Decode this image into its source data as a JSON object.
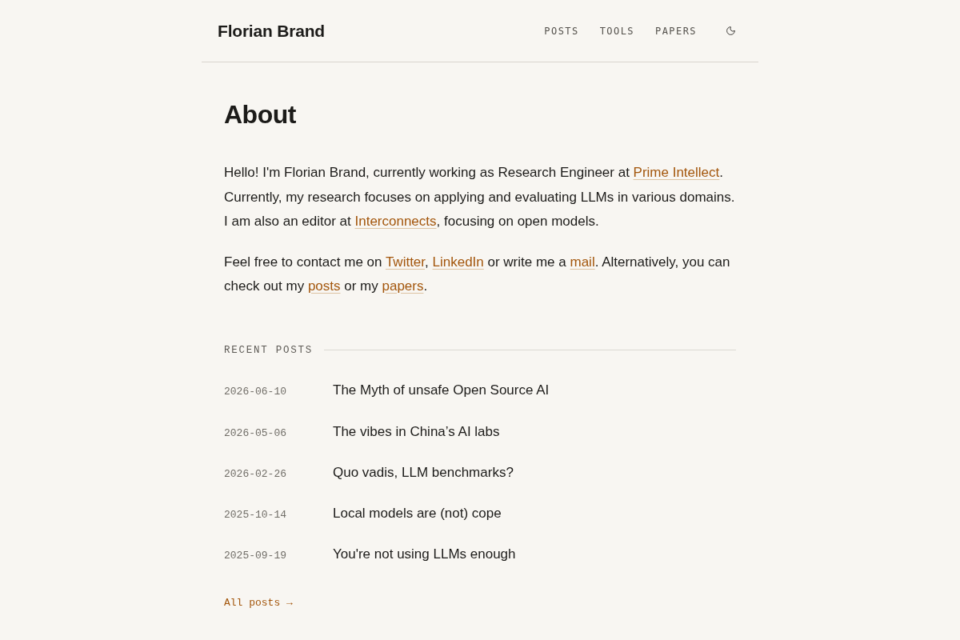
{
  "header": {
    "title": "Florian Brand",
    "nav": [
      "POSTS",
      "TOOLS",
      "PAPERS"
    ]
  },
  "page_title": "About",
  "paragraphs": [
    [
      {
        "kind": "text",
        "text": "Hello! I'm Florian Brand, currently working as Research Engineer at "
      },
      {
        "kind": "link",
        "text": "Prime Intellect"
      },
      {
        "kind": "text",
        "text": ". Currently, my research focuses on applying and evaluating LLMs in various domains. I am also an editor at "
      },
      {
        "kind": "link",
        "text": "Interconnects"
      },
      {
        "kind": "text",
        "text": ", focusing on open models."
      }
    ],
    [
      {
        "kind": "text",
        "text": "Feel free to contact me on "
      },
      {
        "kind": "link",
        "text": "Twitter"
      },
      {
        "kind": "text",
        "text": ", "
      },
      {
        "kind": "link",
        "text": "LinkedIn"
      },
      {
        "kind": "text",
        "text": " or write me a "
      },
      {
        "kind": "link",
        "text": "mail"
      },
      {
        "kind": "text",
        "text": ". Alternatively, you can check out my "
      },
      {
        "kind": "link",
        "text": "posts"
      },
      {
        "kind": "text",
        "text": " or my "
      },
      {
        "kind": "link",
        "text": "papers"
      },
      {
        "kind": "text",
        "text": "."
      }
    ]
  ],
  "recent_posts": {
    "heading": "RECENT POSTS",
    "posts": [
      {
        "date": "2026-06-10",
        "title": "The Myth of unsafe Open Source AI"
      },
      {
        "date": "2026-05-06",
        "title": "The vibes in China’s AI labs"
      },
      {
        "date": "2026-02-26",
        "title": "Quo vadis, LLM benchmarks?"
      },
      {
        "date": "2025-10-14",
        "title": "Local models are (not) cope"
      },
      {
        "date": "2025-09-19",
        "title": "You're not using LLMs enough"
      }
    ],
    "all_link": "All posts →"
  }
}
